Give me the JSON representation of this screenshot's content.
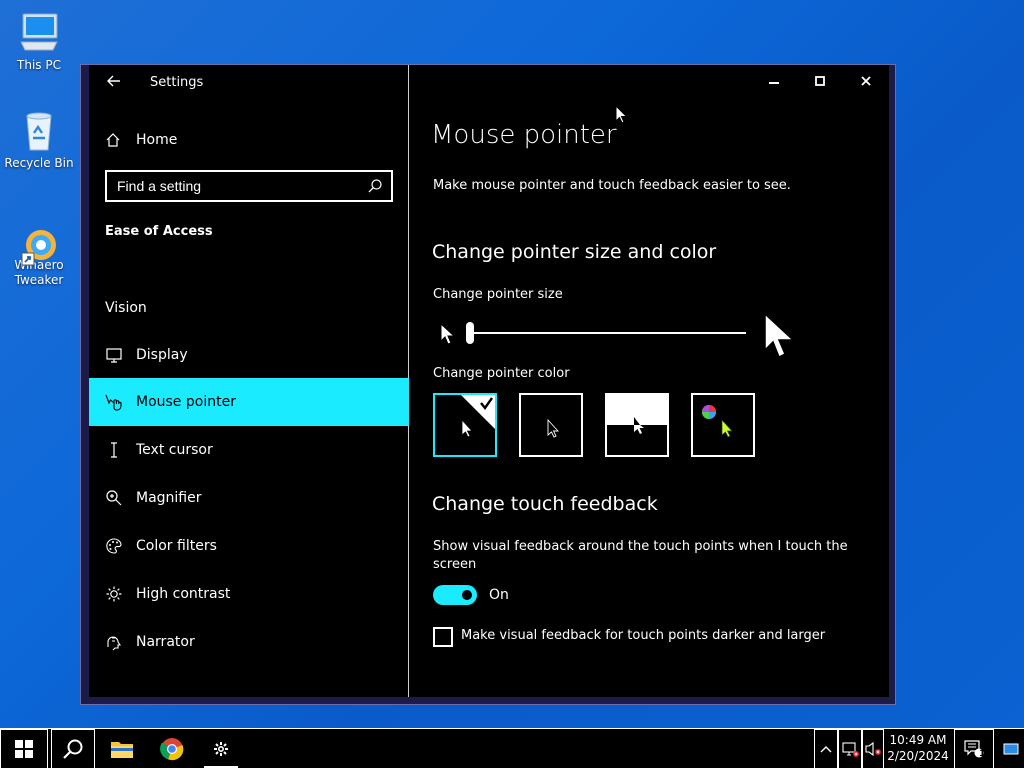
{
  "desktop": {
    "icons": [
      {
        "label": "This PC",
        "icon": "computer-icon"
      },
      {
        "label": "Recycle Bin",
        "icon": "recycle-bin-icon"
      },
      {
        "label": "Winaero\nTweaker",
        "icon": "winaero-tweaker-icon"
      }
    ]
  },
  "window": {
    "app_title": "Settings",
    "controls": {
      "minimize": "minimize-icon",
      "maximize": "maximize-icon",
      "close": "close-icon"
    }
  },
  "sidebar": {
    "home_label": "Home",
    "search_placeholder": "Find a setting",
    "category": "Ease of Access",
    "group_label": "Vision",
    "items": [
      {
        "label": "Display",
        "icon": "display-icon"
      },
      {
        "label": "Mouse pointer",
        "icon": "mouse-pointer-icon",
        "active": true
      },
      {
        "label": "Text cursor",
        "icon": "text-cursor-icon"
      },
      {
        "label": "Magnifier",
        "icon": "magnifier-icon"
      },
      {
        "label": "Color filters",
        "icon": "color-filters-icon"
      },
      {
        "label": "High contrast",
        "icon": "high-contrast-icon"
      },
      {
        "label": "Narrator",
        "icon": "narrator-icon"
      }
    ]
  },
  "content": {
    "title": "Mouse pointer",
    "description": "Make mouse pointer and touch feedback easier to see.",
    "size_color_heading": "Change pointer size and color",
    "size_label": "Change pointer size",
    "pointer_size_value": 1,
    "pointer_size_range": [
      1,
      15
    ],
    "color_label": "Change pointer color",
    "pointer_colors": [
      {
        "name": "white",
        "selected": true
      },
      {
        "name": "black",
        "selected": false
      },
      {
        "name": "inverted",
        "selected": false
      },
      {
        "name": "custom",
        "selected": false
      }
    ],
    "touch_heading": "Change touch feedback",
    "touch_desc_line1": "Show visual feedback around the touch points when I touch the",
    "touch_desc_line2": "screen",
    "toggle_state": "On",
    "darker_label": "Make visual feedback for touch points darker and larger",
    "darker_checked": false
  },
  "taskbar": {
    "time": "10:49 AM",
    "date": "2/20/2024",
    "notification_count": "1",
    "apps": [
      "start-icon",
      "search-icon",
      "file-explorer-icon",
      "chrome-icon",
      "settings-icon"
    ]
  },
  "colors": {
    "accent": "#1aebff",
    "desktop": "#0d68d8",
    "window_bg": "#000000"
  }
}
